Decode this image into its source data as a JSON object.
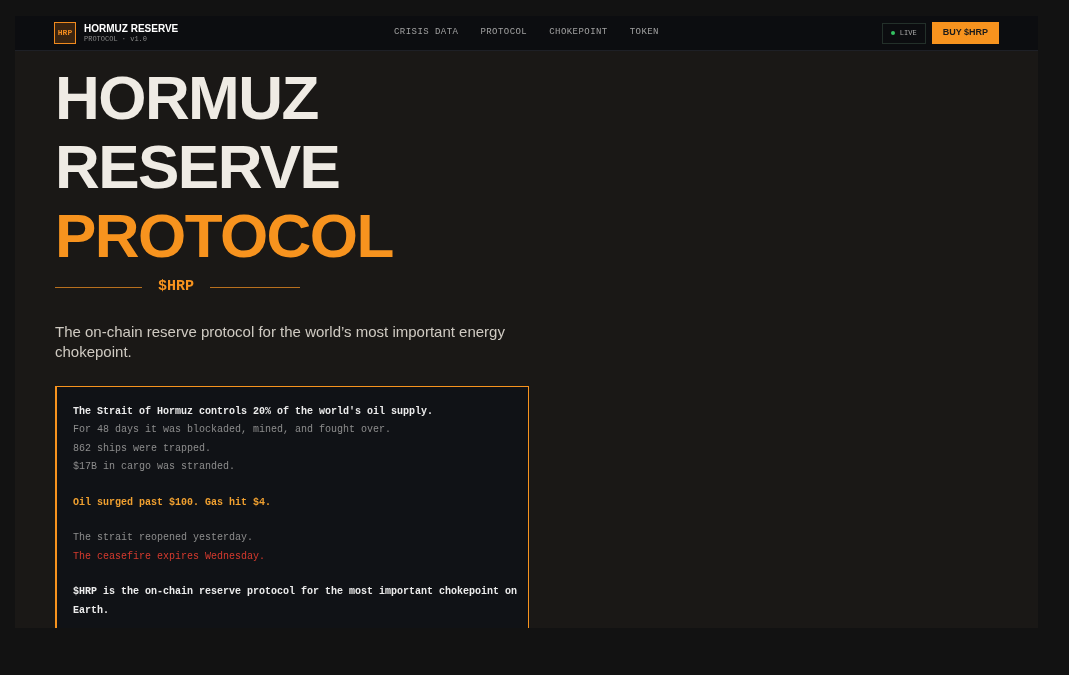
{
  "brand": {
    "logo": "HRP",
    "name": "HORMUZ RESERVE",
    "version": "PROTOCOL · v1.0"
  },
  "nav": [
    {
      "label": "CRISIS DATA"
    },
    {
      "label": "PROTOCOL"
    },
    {
      "label": "CHOKEPOINT"
    },
    {
      "label": "TOKEN"
    }
  ],
  "status": {
    "label": "LIVE",
    "live": true
  },
  "cta": "BUY $HRP",
  "hero": {
    "title": [
      {
        "text": "HORMUZ",
        "kind": "plain"
      },
      {
        "text": "RESERVE",
        "kind": "plain"
      },
      {
        "text": "PROTOCOL",
        "kind": "accent"
      }
    ],
    "ticker": "$HRP",
    "subtitle": "The on-chain reserve protocol for the world’s most important energy chokepoint."
  },
  "story": [
    [
      {
        "text": "The Strait of Hormuz controls 20% of the world's oil supply.",
        "kind": "bold"
      },
      {
        "text": "For 48 days it was blockaded, mined, and fought over.",
        "kind": "muted"
      },
      {
        "text": "862 ships were trapped.",
        "kind": "muted"
      },
      {
        "text": "$17B in cargo was stranded.",
        "kind": "muted"
      }
    ],
    [
      {
        "text": "Oil surged past $100. Gas hit $4.",
        "kind": "accent"
      }
    ],
    [
      {
        "text": "The strait reopened yesterday.",
        "kind": "muted"
      },
      {
        "text": "The ceasefire expires Wednesday.",
        "kind": "alert"
      }
    ],
    [
      {
        "text": "$HRP is the on-chain reserve protocol for the most important chokepoint on Earth.",
        "kind": "bold"
      }
    ]
  ]
}
